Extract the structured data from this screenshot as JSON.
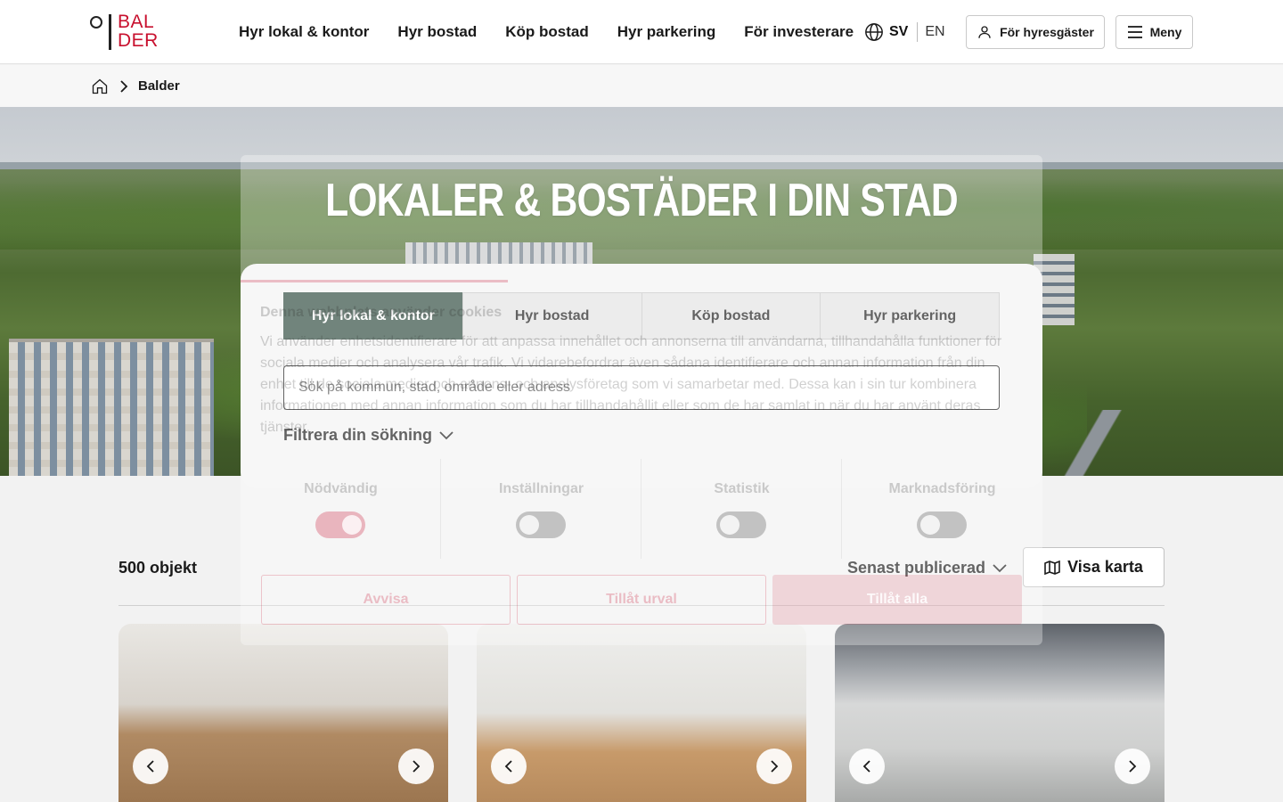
{
  "header": {
    "logo_text": [
      "BAL",
      "DER"
    ],
    "nav": [
      "Hyr lokal & kontor",
      "Hyr bostad",
      "Köp bostad",
      "Hyr parkering",
      "För investerare"
    ],
    "lang_active": "SV",
    "lang_other": "EN",
    "tenants_label": "För hyresgäster",
    "menu_label": "Meny"
  },
  "breadcrumb": {
    "current": "Balder"
  },
  "hero": {
    "title": "LOKALER & BOSTÄDER I DIN STAD"
  },
  "search": {
    "tabs": [
      "Hyr lokal & kontor",
      "Hyr bostad",
      "Köp bostad",
      "Hyr parkering"
    ],
    "active_tab": 0,
    "placeholder": "Sök på kommun, stad, område eller adress",
    "filter_label": "Filtrera din sökning"
  },
  "results": {
    "count": "500 objekt",
    "sort_label": "Senast publicerad",
    "map_label": "Visa karta"
  },
  "cookie": {
    "title": "Denna webbplats använder cookies",
    "text": "Vi använder enhetsidentifierare för att anpassa innehållet och annonserna till användarna, tillhandahålla funktioner för sociala medier och analysera vår trafik. Vi vidarebefordrar även sådana identifierare och annan information från din enhet till de sociala medier och annons- och analysföretag som vi samarbetar med. Dessa kan i sin tur kombinera informationen med annan information som du har tillhandahållit eller som de har samlat in när du har använt deras tjänster.",
    "categories": [
      "Nödvändig",
      "Inställningar",
      "Statistik",
      "Marknadsföring"
    ],
    "buttons": {
      "reject": "Avvisa",
      "selection": "Tillåt urval",
      "all": "Tillåt alla"
    }
  },
  "colors": {
    "brand_red": "#c8102e",
    "tab_active": "#2f4a3e"
  }
}
